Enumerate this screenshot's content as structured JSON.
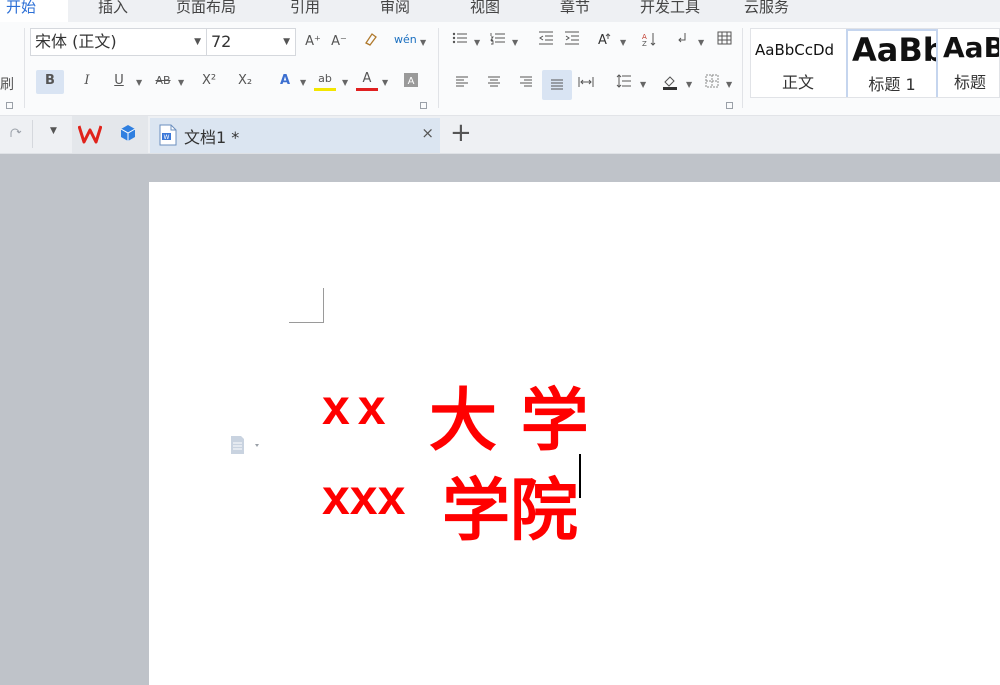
{
  "menu_tabs": [
    {
      "label": "开始",
      "active": true
    },
    {
      "label": "插入"
    },
    {
      "label": "页面布局"
    },
    {
      "label": "引用"
    },
    {
      "label": "审阅"
    },
    {
      "label": "视图"
    },
    {
      "label": "章节"
    },
    {
      "label": "开发工具"
    },
    {
      "label": "云服务"
    }
  ],
  "ribbon": {
    "clipboard_partial_label": "刷",
    "font_name": "宋体 (正文)",
    "font_size": "72",
    "bold_label": "B",
    "italic_label": "I",
    "underline_label": "U",
    "strike_label": "AB",
    "superscript_label": "X²",
    "subscript_label": "X₂",
    "grow_font_label": "A⁺",
    "shrink_font_label": "A⁻",
    "pinyin_label": "wén",
    "font_color_label": "A",
    "highlight_label": "ab",
    "text_effect_label": "A"
  },
  "styles_gallery": [
    {
      "preview": "AaBbCcDd",
      "name": "正文"
    },
    {
      "preview": "AaBb",
      "name": "标题 1",
      "selected": true
    },
    {
      "preview": "AaB",
      "name": "标题"
    }
  ],
  "doc_tab": {
    "title": "文档1 *",
    "close": "×",
    "add": "+"
  },
  "document": {
    "line1_latin": "xx",
    "line1_cjk": "大 学",
    "line2_latin": "xxx",
    "line2_cjk": "学院"
  },
  "colors": {
    "accent": "#2b6fd6",
    "doc_text": "#ff0000",
    "wps_red": "#e0231b"
  }
}
